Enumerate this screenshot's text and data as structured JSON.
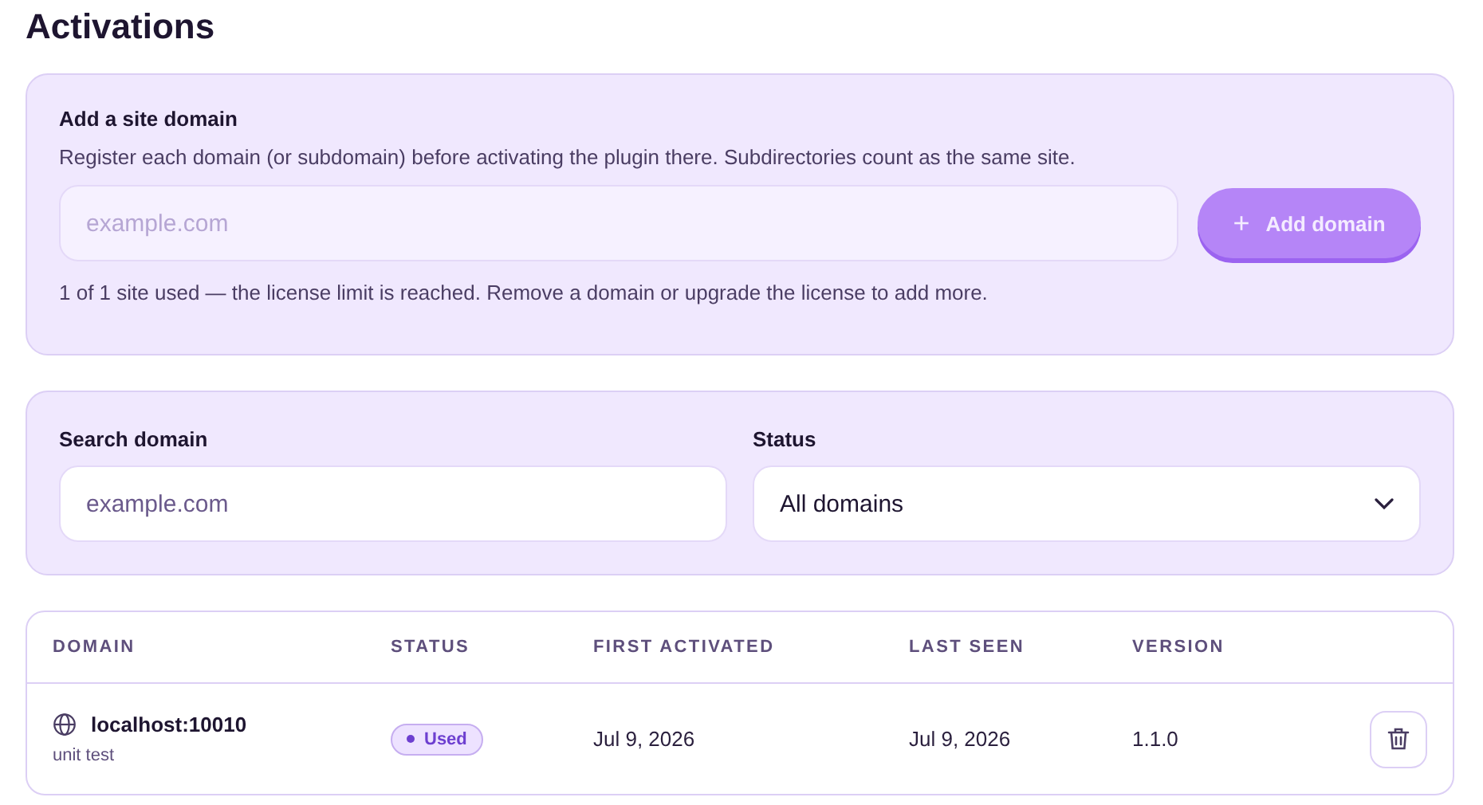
{
  "title": "Activations",
  "add_panel": {
    "heading": "Add a site domain",
    "description": "Register each domain (or subdomain) before activating the plugin there. Subdirectories count as the same site.",
    "field": {
      "placeholder": "example.com",
      "disabled": true
    },
    "button": {
      "label": "Add domain",
      "icon": "+",
      "disabled": true
    },
    "note": "1 of 1 site used — the license limit is reached. Remove a domain or upgrade the license to add more."
  },
  "filters": {
    "search": {
      "label": "Search domain",
      "placeholder": "example.com"
    },
    "status": {
      "label": "Status",
      "value": "All domains"
    }
  },
  "table": {
    "columns": [
      "DOMAIN",
      "STATUS",
      "FIRST ACTIVATED",
      "LAST SEEN",
      "VERSION"
    ],
    "rows": [
      {
        "domain": "localhost:10010",
        "note": "unit test",
        "status": "Used",
        "first_activated": "Jul 9, 2026",
        "last_seen": "Jul 9, 2026",
        "version": "1.1.0"
      }
    ]
  }
}
